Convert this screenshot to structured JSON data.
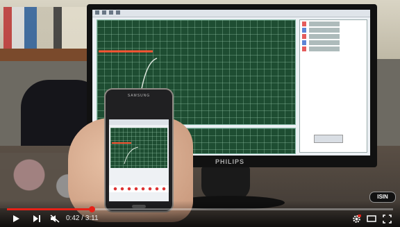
{
  "monitor": {
    "brand": "PHILIPS"
  },
  "phone": {
    "brand": "SAMSUNG"
  },
  "watermark": {
    "text": "ISIN"
  },
  "player": {
    "current_time": "0:42",
    "separator": " / ",
    "duration": "3:11",
    "progress": 0.22,
    "accent_color": "#e62117",
    "controls": {
      "play": "play-icon",
      "next": "next-icon",
      "mute": "volume-muted-icon",
      "settings": "settings-gear-icon",
      "theater": "theater-mode-icon",
      "fullscreen": "fullscreen-icon"
    }
  }
}
